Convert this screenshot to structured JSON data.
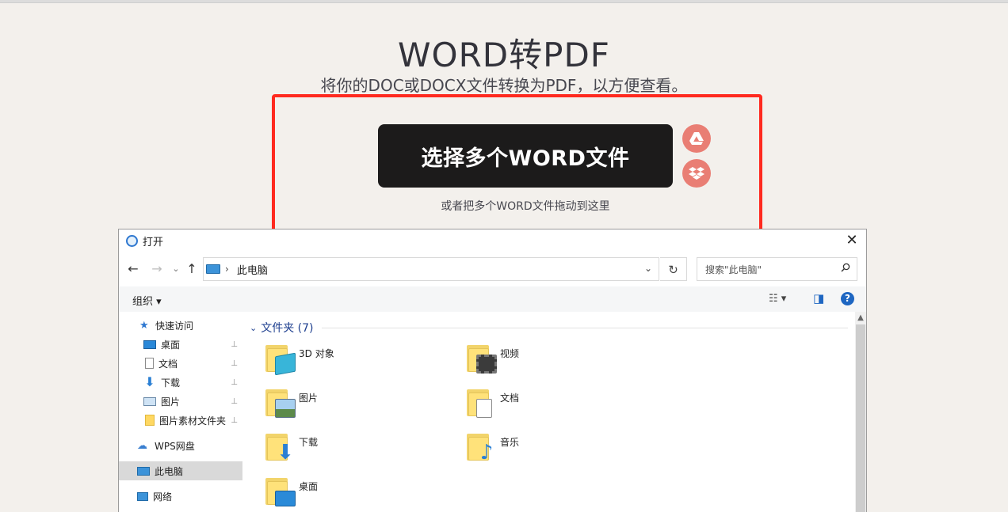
{
  "page": {
    "title": "WORD转PDF",
    "subtitle": "将你的DOC或DOCX文件转换为PDF，以方便查看。",
    "select_button": "选择多个WORD文件",
    "drop_hint": "或者把多个WORD文件拖动到这里",
    "cloud_buttons": [
      "google-drive-icon",
      "dropbox-icon"
    ],
    "accent_color": "#e97e74",
    "highlight_color": "#ff2a1f"
  },
  "dialog": {
    "title": "打开",
    "close_glyph": "✕",
    "nav": {
      "back": "←",
      "forward": "→",
      "recent": "⌄",
      "up": "↑"
    },
    "address": {
      "separator": "›",
      "location": "此电脑",
      "dropdown": "⌄"
    },
    "refresh_glyph": "↻",
    "search_placeholder": "搜索\"此电脑\"",
    "toolbar": {
      "organize": "组织 ▾",
      "view_glyph": "☷ ▾",
      "pane_glyph": "◨",
      "help": "?"
    },
    "sidebar": [
      {
        "label": "快速访问",
        "icon": "star-icon",
        "pinned": false
      },
      {
        "label": "桌面",
        "icon": "desktop-icon",
        "pinned": true
      },
      {
        "label": "文档",
        "icon": "document-icon",
        "pinned": true
      },
      {
        "label": "下载",
        "icon": "download-icon",
        "pinned": true
      },
      {
        "label": "图片",
        "icon": "picture-icon",
        "pinned": true
      },
      {
        "label": "图片素材文件夹",
        "icon": "folder-icon",
        "pinned": true
      },
      {
        "label": "WPS网盘",
        "icon": "cloud-icon",
        "pinned": false
      },
      {
        "label": "此电脑",
        "icon": "computer-icon",
        "pinned": false,
        "selected": true
      },
      {
        "label": "网络",
        "icon": "network-icon",
        "pinned": false
      }
    ],
    "pin_glyph": "📌",
    "group_header": "文件夹 (7)",
    "folders": [
      {
        "name": "3D 对象",
        "icon": "3d-objects-icon"
      },
      {
        "name": "视频",
        "icon": "videos-icon"
      },
      {
        "name": "图片",
        "icon": "pictures-icon"
      },
      {
        "name": "文档",
        "icon": "documents-icon"
      },
      {
        "name": "下载",
        "icon": "downloads-icon"
      },
      {
        "name": "音乐",
        "icon": "music-icon"
      },
      {
        "name": "桌面",
        "icon": "desktop-folder-icon"
      }
    ]
  }
}
